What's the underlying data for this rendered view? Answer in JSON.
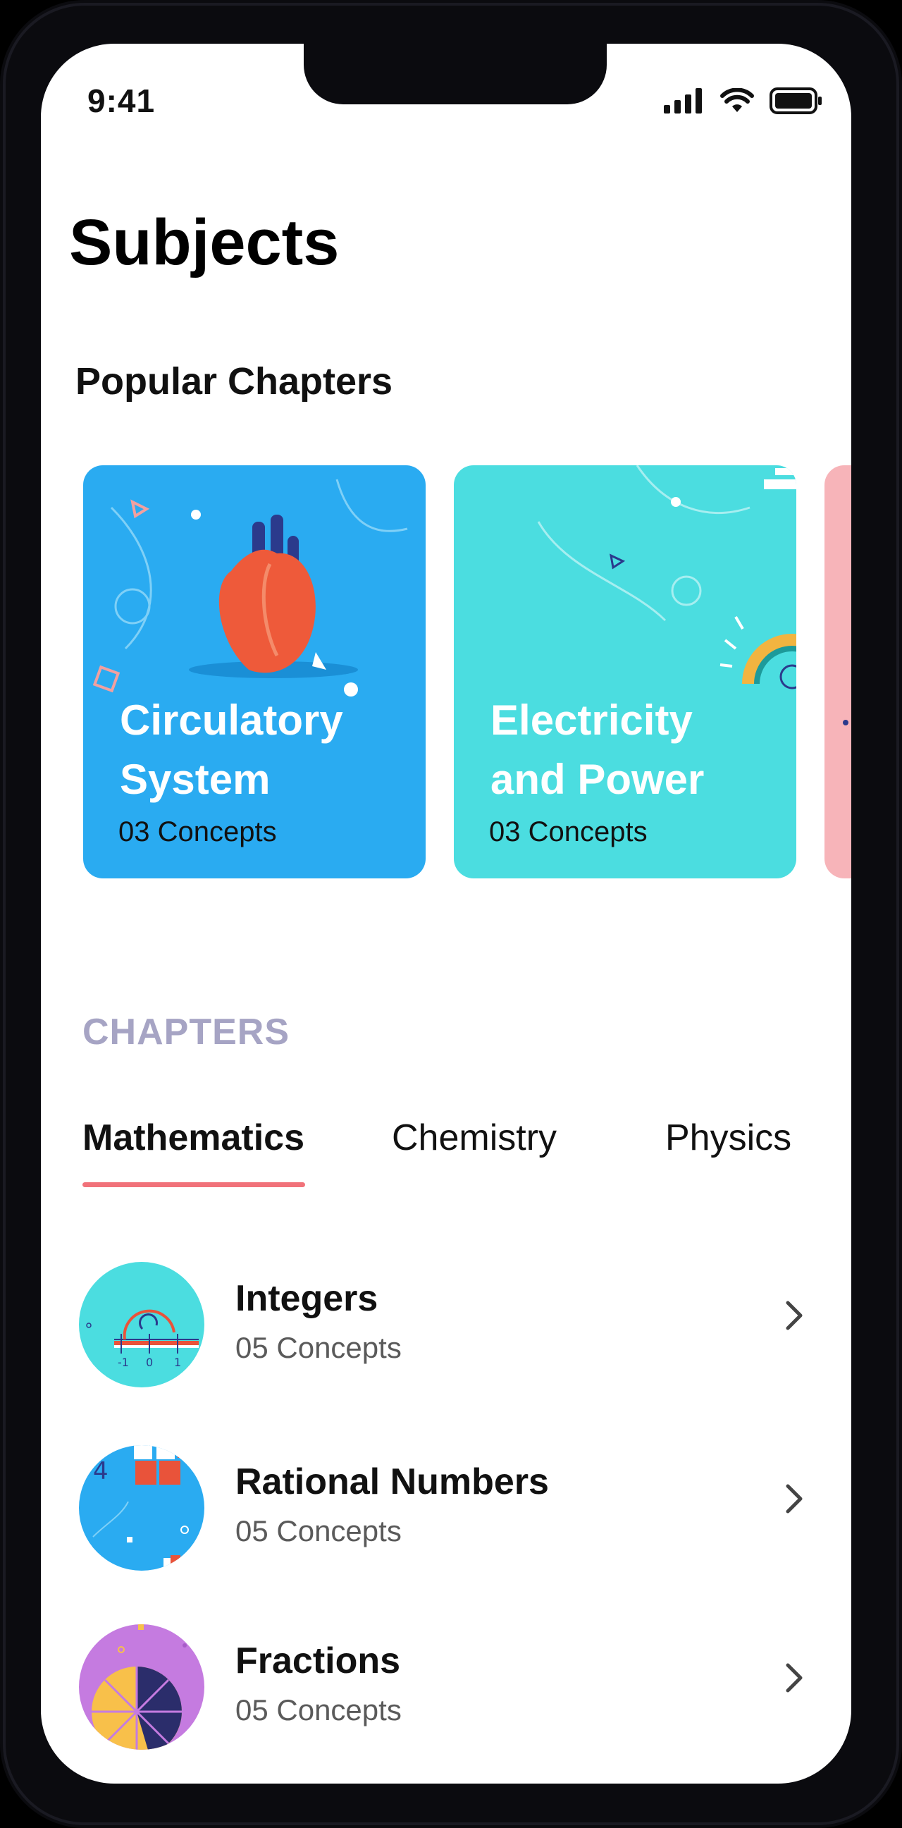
{
  "status_bar": {
    "time": "9:41"
  },
  "page_title": "Subjects",
  "popular_chapters": {
    "heading": "Popular Chapters",
    "cards": [
      {
        "title_line1": "Circulatory",
        "title_line2": "System",
        "subtitle": "03 Concepts",
        "color": "#2aabf1"
      },
      {
        "title_line1": "Electricity",
        "title_line2": "and Power",
        "subtitle": "03 Concepts",
        "color": "#4bdde0"
      },
      {
        "color": "#f7b4b9"
      }
    ]
  },
  "chapters": {
    "heading": "CHAPTERS",
    "tabs": [
      {
        "label": "Mathematics",
        "active": true
      },
      {
        "label": "Chemistry",
        "active": false
      },
      {
        "label": "Physics",
        "active": false
      }
    ],
    "accent_color": "#f1727a",
    "items": [
      {
        "title": "Integers",
        "subtitle": "05 Concepts",
        "icon": "number-line-icon",
        "color": "#4bdde0"
      },
      {
        "title": "Rational Numbers",
        "subtitle": "05 Concepts",
        "icon": "blocks-icon",
        "color": "#2aabf1"
      },
      {
        "title": "Fractions",
        "subtitle": "05 Concepts",
        "icon": "pie-fraction-icon",
        "color": "#c57be0"
      }
    ]
  }
}
